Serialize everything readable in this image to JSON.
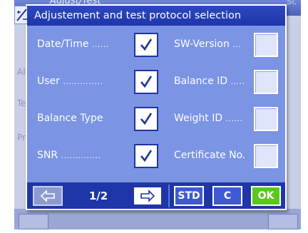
{
  "background": {
    "title": "Adjust/Test",
    "right_text": "Sc",
    "side_labels": [
      "Al",
      "Te",
      "Pr"
    ]
  },
  "dialog": {
    "title": "Adjustement and test protocol selection",
    "left_options": [
      {
        "label": "Date/Time",
        "dots": "......",
        "checked": true
      },
      {
        "label": "User",
        "dots": "..............",
        "checked": true
      },
      {
        "label": "Balance Type",
        "dots": "",
        "checked": true
      },
      {
        "label": "SNR",
        "dots": "..............",
        "checked": true
      }
    ],
    "right_options": [
      {
        "label": "SW-Version",
        "dots": "...",
        "checked": false
      },
      {
        "label": "Balance ID",
        "dots": ".....",
        "checked": false
      },
      {
        "label": "Weight ID",
        "dots": "......",
        "checked": false
      },
      {
        "label": "Certificate No.",
        "dots": "",
        "checked": false
      }
    ],
    "footer": {
      "page_indicator": "1/2",
      "std_label": "STD",
      "clear_label": "C",
      "ok_label": "OK"
    }
  },
  "colors": {
    "dialog_body": "#7b94e4",
    "title_bar": "#1e36a8",
    "ok_green": "#5ac81e",
    "check_blue": "#2234a0"
  },
  "icons": {
    "check": "check-icon",
    "prev": "arrow-left-icon",
    "next": "arrow-right-icon",
    "app": "adjust-app-icon"
  }
}
